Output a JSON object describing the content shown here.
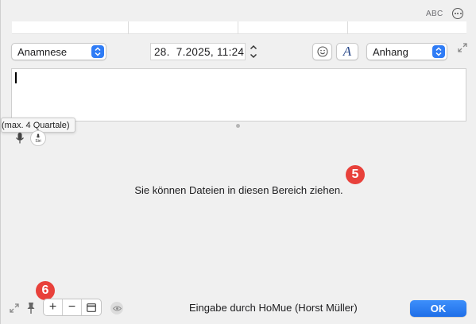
{
  "header": {
    "abc_label": "ABC"
  },
  "form": {
    "type_select": {
      "value": "Anamnese"
    },
    "datetime": {
      "value": "28.  7.2025, 11:24"
    },
    "attachment_select": {
      "value": "Anhang"
    },
    "text_placeholder": ""
  },
  "tooltip": {
    "text": "(max. 4 Quartale)"
  },
  "siri": {
    "label": "Siri"
  },
  "drop_zone": {
    "hint": "Sie können Dateien in diesen Bereich ziehen."
  },
  "badges": {
    "five": "5",
    "six": "6"
  },
  "footer": {
    "add": "+",
    "remove": "−",
    "entry_by": "Eingabe durch HoMue (Horst Müller)",
    "ok_label": "OK"
  },
  "colors": {
    "accent": "#2f7cf6",
    "badge": "#e8413b"
  }
}
